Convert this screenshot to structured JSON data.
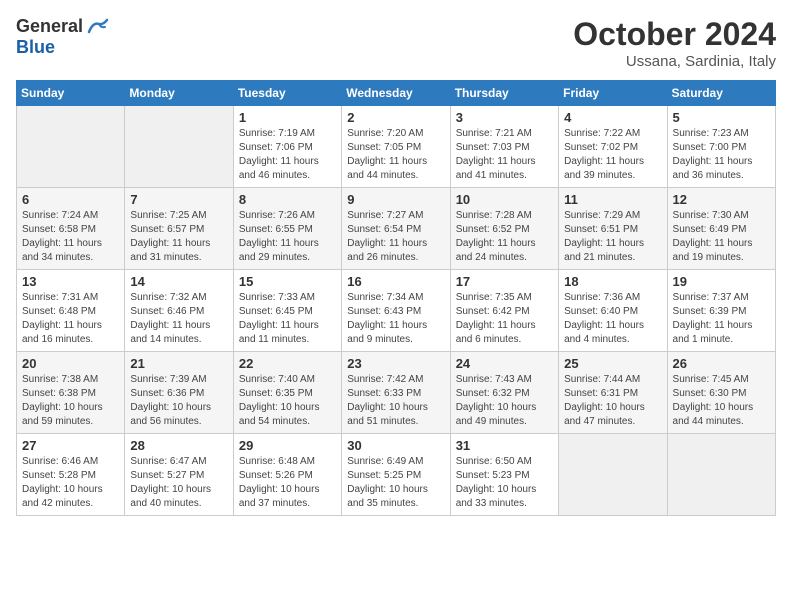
{
  "header": {
    "logo_general": "General",
    "logo_blue": "Blue",
    "month_year": "October 2024",
    "location": "Ussana, Sardinia, Italy"
  },
  "days_of_week": [
    "Sunday",
    "Monday",
    "Tuesday",
    "Wednesday",
    "Thursday",
    "Friday",
    "Saturday"
  ],
  "weeks": [
    [
      {
        "day": "",
        "empty": true
      },
      {
        "day": "",
        "empty": true
      },
      {
        "day": "1",
        "sunrise": "Sunrise: 7:19 AM",
        "sunset": "Sunset: 7:06 PM",
        "daylight": "Daylight: 11 hours and 46 minutes."
      },
      {
        "day": "2",
        "sunrise": "Sunrise: 7:20 AM",
        "sunset": "Sunset: 7:05 PM",
        "daylight": "Daylight: 11 hours and 44 minutes."
      },
      {
        "day": "3",
        "sunrise": "Sunrise: 7:21 AM",
        "sunset": "Sunset: 7:03 PM",
        "daylight": "Daylight: 11 hours and 41 minutes."
      },
      {
        "day": "4",
        "sunrise": "Sunrise: 7:22 AM",
        "sunset": "Sunset: 7:02 PM",
        "daylight": "Daylight: 11 hours and 39 minutes."
      },
      {
        "day": "5",
        "sunrise": "Sunrise: 7:23 AM",
        "sunset": "Sunset: 7:00 PM",
        "daylight": "Daylight: 11 hours and 36 minutes."
      }
    ],
    [
      {
        "day": "6",
        "sunrise": "Sunrise: 7:24 AM",
        "sunset": "Sunset: 6:58 PM",
        "daylight": "Daylight: 11 hours and 34 minutes."
      },
      {
        "day": "7",
        "sunrise": "Sunrise: 7:25 AM",
        "sunset": "Sunset: 6:57 PM",
        "daylight": "Daylight: 11 hours and 31 minutes."
      },
      {
        "day": "8",
        "sunrise": "Sunrise: 7:26 AM",
        "sunset": "Sunset: 6:55 PM",
        "daylight": "Daylight: 11 hours and 29 minutes."
      },
      {
        "day": "9",
        "sunrise": "Sunrise: 7:27 AM",
        "sunset": "Sunset: 6:54 PM",
        "daylight": "Daylight: 11 hours and 26 minutes."
      },
      {
        "day": "10",
        "sunrise": "Sunrise: 7:28 AM",
        "sunset": "Sunset: 6:52 PM",
        "daylight": "Daylight: 11 hours and 24 minutes."
      },
      {
        "day": "11",
        "sunrise": "Sunrise: 7:29 AM",
        "sunset": "Sunset: 6:51 PM",
        "daylight": "Daylight: 11 hours and 21 minutes."
      },
      {
        "day": "12",
        "sunrise": "Sunrise: 7:30 AM",
        "sunset": "Sunset: 6:49 PM",
        "daylight": "Daylight: 11 hours and 19 minutes."
      }
    ],
    [
      {
        "day": "13",
        "sunrise": "Sunrise: 7:31 AM",
        "sunset": "Sunset: 6:48 PM",
        "daylight": "Daylight: 11 hours and 16 minutes."
      },
      {
        "day": "14",
        "sunrise": "Sunrise: 7:32 AM",
        "sunset": "Sunset: 6:46 PM",
        "daylight": "Daylight: 11 hours and 14 minutes."
      },
      {
        "day": "15",
        "sunrise": "Sunrise: 7:33 AM",
        "sunset": "Sunset: 6:45 PM",
        "daylight": "Daylight: 11 hours and 11 minutes."
      },
      {
        "day": "16",
        "sunrise": "Sunrise: 7:34 AM",
        "sunset": "Sunset: 6:43 PM",
        "daylight": "Daylight: 11 hours and 9 minutes."
      },
      {
        "day": "17",
        "sunrise": "Sunrise: 7:35 AM",
        "sunset": "Sunset: 6:42 PM",
        "daylight": "Daylight: 11 hours and 6 minutes."
      },
      {
        "day": "18",
        "sunrise": "Sunrise: 7:36 AM",
        "sunset": "Sunset: 6:40 PM",
        "daylight": "Daylight: 11 hours and 4 minutes."
      },
      {
        "day": "19",
        "sunrise": "Sunrise: 7:37 AM",
        "sunset": "Sunset: 6:39 PM",
        "daylight": "Daylight: 11 hours and 1 minute."
      }
    ],
    [
      {
        "day": "20",
        "sunrise": "Sunrise: 7:38 AM",
        "sunset": "Sunset: 6:38 PM",
        "daylight": "Daylight: 10 hours and 59 minutes."
      },
      {
        "day": "21",
        "sunrise": "Sunrise: 7:39 AM",
        "sunset": "Sunset: 6:36 PM",
        "daylight": "Daylight: 10 hours and 56 minutes."
      },
      {
        "day": "22",
        "sunrise": "Sunrise: 7:40 AM",
        "sunset": "Sunset: 6:35 PM",
        "daylight": "Daylight: 10 hours and 54 minutes."
      },
      {
        "day": "23",
        "sunrise": "Sunrise: 7:42 AM",
        "sunset": "Sunset: 6:33 PM",
        "daylight": "Daylight: 10 hours and 51 minutes."
      },
      {
        "day": "24",
        "sunrise": "Sunrise: 7:43 AM",
        "sunset": "Sunset: 6:32 PM",
        "daylight": "Daylight: 10 hours and 49 minutes."
      },
      {
        "day": "25",
        "sunrise": "Sunrise: 7:44 AM",
        "sunset": "Sunset: 6:31 PM",
        "daylight": "Daylight: 10 hours and 47 minutes."
      },
      {
        "day": "26",
        "sunrise": "Sunrise: 7:45 AM",
        "sunset": "Sunset: 6:30 PM",
        "daylight": "Daylight: 10 hours and 44 minutes."
      }
    ],
    [
      {
        "day": "27",
        "sunrise": "Sunrise: 6:46 AM",
        "sunset": "Sunset: 5:28 PM",
        "daylight": "Daylight: 10 hours and 42 minutes."
      },
      {
        "day": "28",
        "sunrise": "Sunrise: 6:47 AM",
        "sunset": "Sunset: 5:27 PM",
        "daylight": "Daylight: 10 hours and 40 minutes."
      },
      {
        "day": "29",
        "sunrise": "Sunrise: 6:48 AM",
        "sunset": "Sunset: 5:26 PM",
        "daylight": "Daylight: 10 hours and 37 minutes."
      },
      {
        "day": "30",
        "sunrise": "Sunrise: 6:49 AM",
        "sunset": "Sunset: 5:25 PM",
        "daylight": "Daylight: 10 hours and 35 minutes."
      },
      {
        "day": "31",
        "sunrise": "Sunrise: 6:50 AM",
        "sunset": "Sunset: 5:23 PM",
        "daylight": "Daylight: 10 hours and 33 minutes."
      },
      {
        "day": "",
        "empty": true
      },
      {
        "day": "",
        "empty": true
      }
    ]
  ]
}
